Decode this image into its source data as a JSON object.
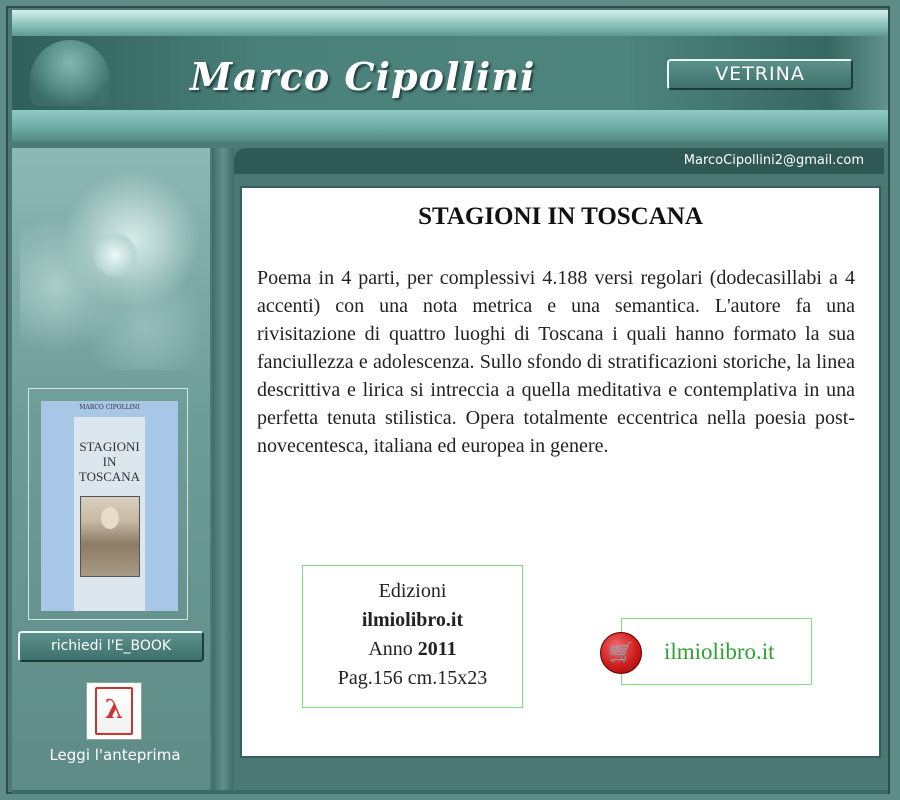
{
  "header": {
    "site_title": "Marco Cipollini",
    "nav_button": "VETRINA"
  },
  "contact": {
    "email": "MarcoCipollini2@gmail.com"
  },
  "sidebar": {
    "cover_author": "MARCO CIPOLLINI",
    "cover_title_line1": "STAGIONI",
    "cover_title_line2": "IN",
    "cover_title_line3": "TOSCANA",
    "ebook_button": "richiedi l'E_BOOK",
    "pdf_icon": "pdf-acrobat-icon",
    "preview_label": "Leggi l'anteprima"
  },
  "main": {
    "book_title": "STAGIONI IN TOSCANA",
    "description": "Poema in 4 parti, per complessivi 4.188 versi regolari (dodecasillabi a 4 accenti) con una nota metrica e una semantica. L'autore fa una rivisitazione di quattro luoghi di Toscana i quali hanno formato la sua fanciullezza e adolescenza. Sullo sfondo di stratificazioni storiche, la linea descrittiva e lirica si intreccia a quella meditativa e contemplativa in una perfetta tenuta stilistica. Opera totalmente eccentrica nella poesia post-novecentesca, italiana ed europea in genere.",
    "edition": {
      "label": "Edizioni",
      "publisher": "ilmiolibro.it",
      "year_label": "Anno",
      "year": "2011",
      "details": "Pag.156 cm.15x23"
    },
    "shop": {
      "icon": "shopping-cart-icon",
      "label": "ilmiolibro.it"
    }
  },
  "colors": {
    "teal_dark": "#2f5954",
    "teal_mid": "#5e8d88",
    "link_green": "#2fa12f",
    "cart_red": "#d01c1c"
  }
}
